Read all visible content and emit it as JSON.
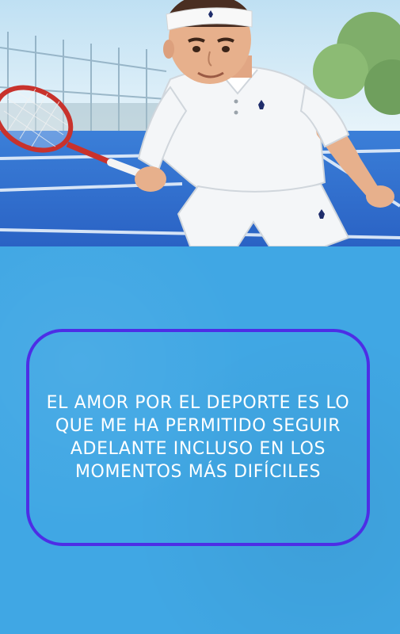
{
  "illustration": {
    "subject_icon": "tennis-player-illustration",
    "colors": {
      "court": "#2f6fd0",
      "sky": "#d6ecf7",
      "shirt": "#f4f6f8",
      "racket": "#c8322c"
    }
  },
  "quote": {
    "text": "EL AMOR POR EL DEPORTE ES LO QUE ME HA PERMITIDO SEGUIR ADELANTE INCLUSO EN LOS MOMENTOS MÁS DIFÍCILES",
    "text_color": "#ffffff",
    "border_color": "#4d2ee6"
  },
  "colors": {
    "panel_background": "#40a7e4"
  }
}
